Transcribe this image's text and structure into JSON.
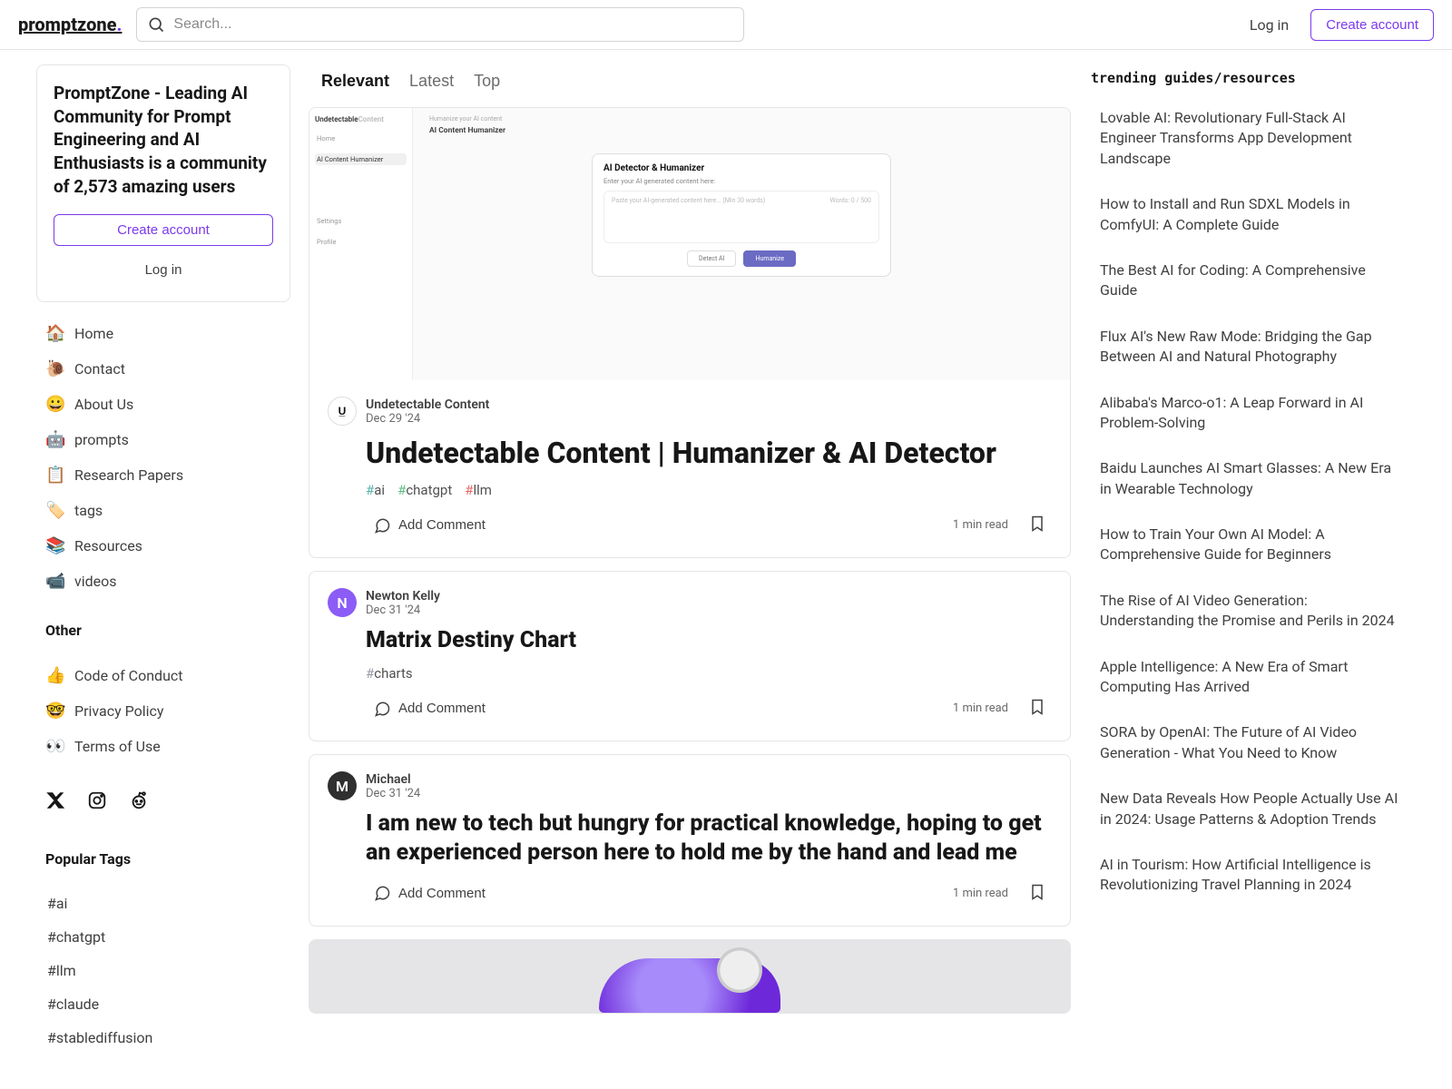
{
  "header": {
    "logo_text": "promptzone",
    "search_placeholder": "Search...",
    "login_label": "Log in",
    "create_label": "Create account"
  },
  "sidebar": {
    "card_title": "PromptZone - Leading AI Community for Prompt Engineering and AI Enthusiasts is a community of 2,573 amazing users",
    "create_label": "Create account",
    "login_label": "Log in",
    "nav": [
      {
        "emoji": "🏠",
        "label": "Home"
      },
      {
        "emoji": "🐌",
        "label": "Contact"
      },
      {
        "emoji": "😀",
        "label": "About Us"
      },
      {
        "emoji": "🤖",
        "label": "prompts"
      },
      {
        "emoji": "📋",
        "label": "Research Papers"
      },
      {
        "emoji": "🏷️",
        "label": "tags"
      },
      {
        "emoji": "📚",
        "label": "Resources"
      },
      {
        "emoji": "📹",
        "label": "videos"
      }
    ],
    "other_heading": "Other",
    "other": [
      {
        "emoji": "👍",
        "label": "Code of Conduct"
      },
      {
        "emoji": "🤓",
        "label": "Privacy Policy"
      },
      {
        "emoji": "👀",
        "label": "Terms of Use"
      }
    ],
    "popular_heading": "Popular Tags",
    "popular_tags": [
      "#ai",
      "#chatgpt",
      "#llm",
      "#claude",
      "#stablediffusion"
    ]
  },
  "tabs": {
    "relevant": "Relevant",
    "latest": "Latest",
    "top": "Top"
  },
  "posts": {
    "p0": {
      "author": "Undetectable Content",
      "avatar_text": "U̲",
      "date": "Dec 29 '24",
      "title": "Undetectable Content | Humanizer & AI Detector",
      "tags": {
        "t0": "ai",
        "t1": "chatgpt",
        "t2": "llm"
      },
      "comment_label": "Add Comment",
      "read_time": "1 min read",
      "cover": {
        "brand_a": "Undetectable",
        "brand_b": "Content",
        "nav_home": "Home",
        "nav_item": "AI Content Humanizer",
        "settings": "Settings",
        "profile": "Profile",
        "crumb": "Humanize your AI content",
        "heading": "AI Content Humanizer",
        "panel_title": "AI Detector & Humanizer",
        "panel_sub": "Enter your AI generated content here:",
        "panel_placeholder": "Paste your AI-generated content here... (Min 30 words)",
        "panel_words": "Words: 0 / 500",
        "btn_detect": "Detect AI",
        "btn_humanize": "Humanize"
      }
    },
    "p1": {
      "author": "Newton Kelly",
      "avatar_text": "N",
      "date": "Dec 31 '24",
      "title": "Matrix Destiny Chart",
      "tags": {
        "t0": "charts"
      },
      "comment_label": "Add Comment",
      "read_time": "1 min read"
    },
    "p2": {
      "author": "Michael",
      "avatar_text": "M",
      "date": "Dec 31 '24",
      "title": "I am new to tech but hungry for practical knowledge, hoping to get an experienced person here to hold me by the hand and lead me",
      "comment_label": "Add Comment",
      "read_time": "1 min read"
    }
  },
  "trending": {
    "heading": "trending guides/resources",
    "items": [
      "Lovable AI: Revolutionary Full-Stack AI Engineer Transforms App Development Landscape",
      "How to Install and Run SDXL Models in ComfyUI: A Complete Guide",
      "The Best AI for Coding: A Comprehensive Guide",
      "Flux AI's New Raw Mode: Bridging the Gap Between AI and Natural Photography",
      "Alibaba's Marco-o1: A Leap Forward in AI Problem-Solving",
      "Baidu Launches AI Smart Glasses: A New Era in Wearable Technology",
      "How to Train Your Own AI Model: A Comprehensive Guide for Beginners",
      "The Rise of AI Video Generation: Understanding the Promise and Perils in 2024",
      "Apple Intelligence: A New Era of Smart Computing Has Arrived",
      "SORA by OpenAI: The Future of AI Video Generation - What You Need to Know",
      "New Data Reveals How People Actually Use AI in 2024: Usage Patterns & Adoption Trends",
      "AI in Tourism: How Artificial Intelligence is Revolutionizing Travel Planning in 2024"
    ]
  }
}
